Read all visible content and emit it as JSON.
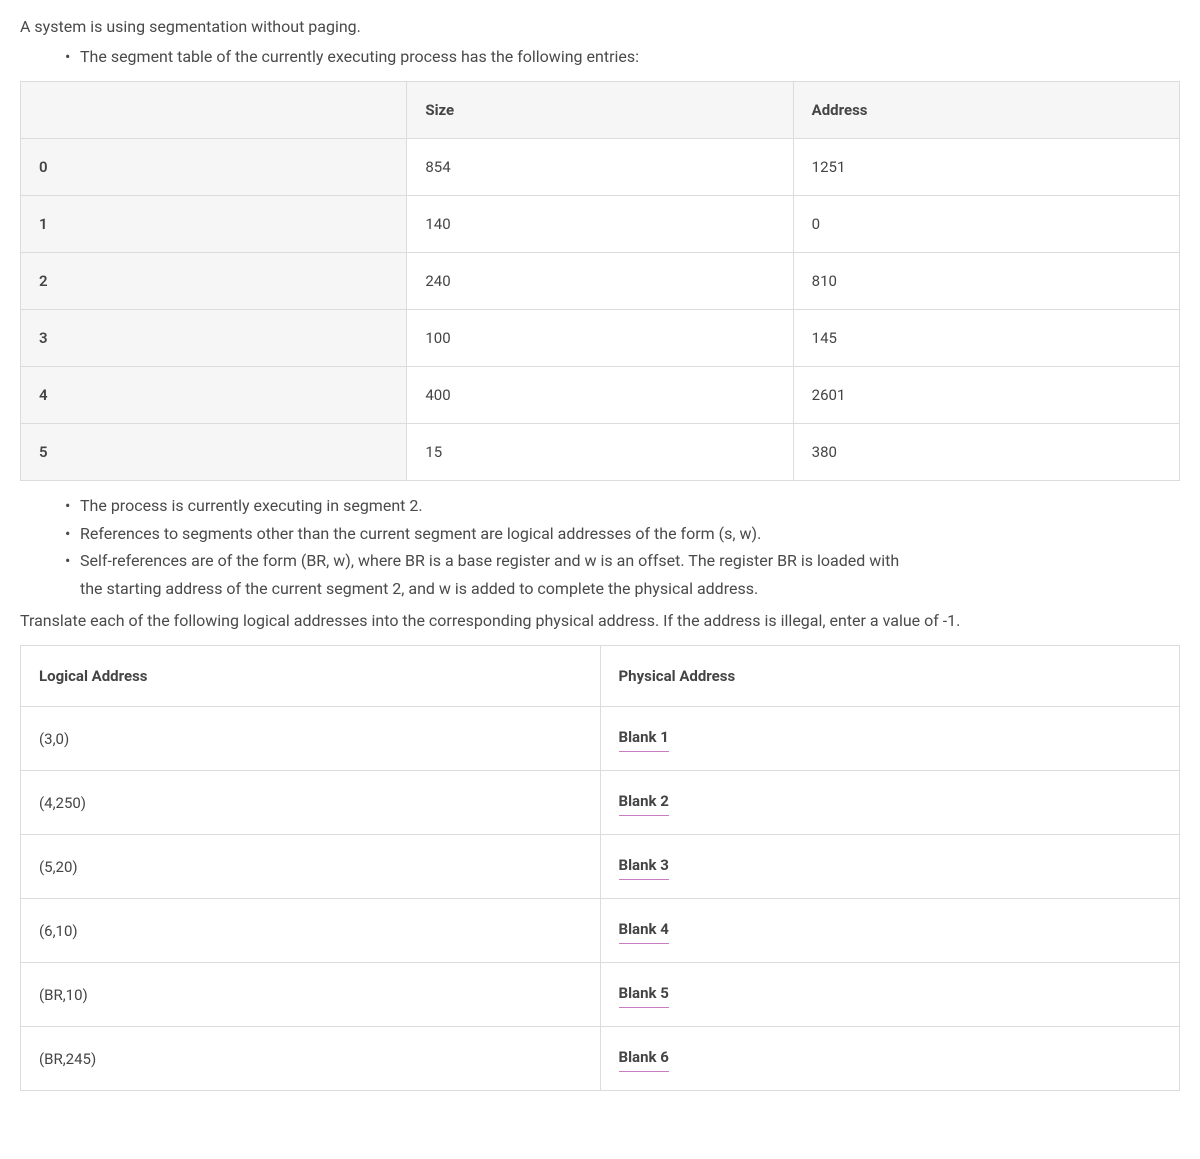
{
  "intro": "A system is using segmentation without paging.",
  "bullets_top": [
    "The segment table of the currently executing process has the following entries:"
  ],
  "seg_table": {
    "headers": {
      "first": "",
      "size": "Size",
      "address": "Address"
    },
    "rows": [
      {
        "idx": "0",
        "size": "854",
        "addr": "1251"
      },
      {
        "idx": "1",
        "size": "140",
        "addr": "0"
      },
      {
        "idx": "2",
        "size": "240",
        "addr": "810"
      },
      {
        "idx": "3",
        "size": "100",
        "addr": "145"
      },
      {
        "idx": "4",
        "size": "400",
        "addr": "2601"
      },
      {
        "idx": "5",
        "size": "15",
        "addr": "380"
      }
    ]
  },
  "bullets_mid": [
    "The process is currently executing in segment 2.",
    "References to segments other than the current segment are logical addresses of the form (s, w).",
    "Self-references are of the form (BR, w), where BR is a base register and w is an offset. The register BR is loaded with",
    "the starting address of the current segment 2, and w is added to complete the physical address."
  ],
  "translate_line": "Translate each of the following logical addresses into the corresponding physical address. If the address is illegal, enter a value of -1.",
  "answer_table": {
    "headers": {
      "logical": "Logical Address",
      "physical": "Physical Address"
    },
    "rows": [
      {
        "logical": "(3,0)",
        "physical": "Blank 1"
      },
      {
        "logical": "(4,250)",
        "physical": "Blank 2"
      },
      {
        "logical": "(5,20)",
        "physical": "Blank 3"
      },
      {
        "logical": "(6,10)",
        "physical": "Blank 4"
      },
      {
        "logical": "(BR,10)",
        "physical": "Blank 5"
      },
      {
        "logical": "(BR,245)",
        "physical": "Blank 6"
      }
    ]
  }
}
